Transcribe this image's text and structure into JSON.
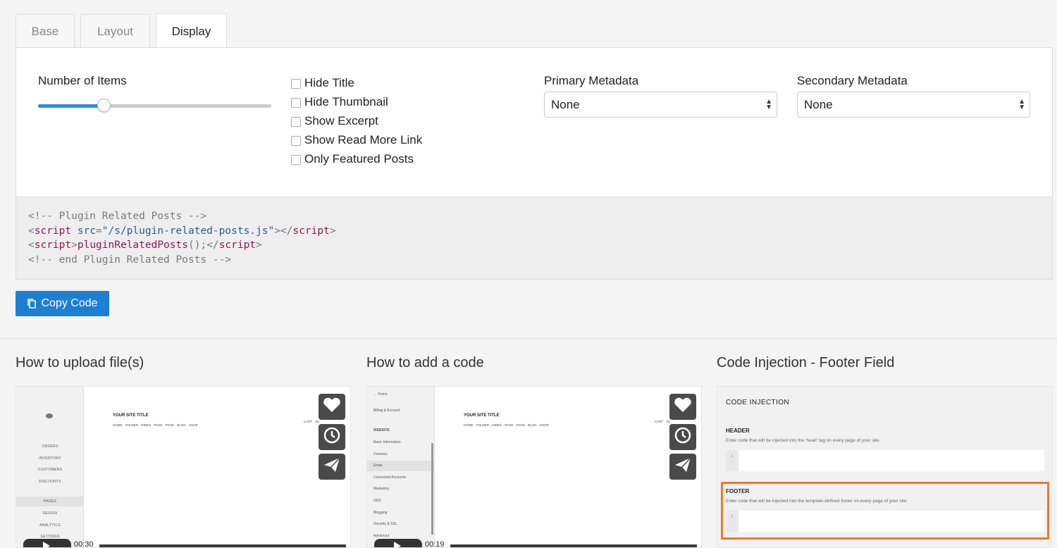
{
  "tabs": [
    {
      "label": "Base",
      "active": false
    },
    {
      "label": "Layout",
      "active": false
    },
    {
      "label": "Display",
      "active": true
    }
  ],
  "display": {
    "number_of_items_label": "Number of Items",
    "number_of_items_fraction": 0.28,
    "checkboxes": [
      {
        "label": "Hide Title",
        "checked": false
      },
      {
        "label": "Hide Thumbnail",
        "checked": false
      },
      {
        "label": "Show Excerpt",
        "checked": false
      },
      {
        "label": "Show Read More Link",
        "checked": false
      },
      {
        "label": "Only Featured Posts",
        "checked": false
      }
    ],
    "primary_metadata_label": "Primary Metadata",
    "primary_metadata_value": "None",
    "secondary_metadata_label": "Secondary Metadata",
    "secondary_metadata_value": "None"
  },
  "code": {
    "line1": "<!-- Plugin Related Posts -->",
    "line2_tag_open": "<script",
    "line2_attr": " src",
    "line2_eq": "=",
    "line2_str": "\"/s/plugin-related-posts.js\"",
    "line2_close": "></",
    "line2_tag_close": "script",
    "line2_end": ">",
    "line3_open_lt": "<",
    "line3_tag": "script",
    "line3_gt": ">",
    "line3_call": "pluginRelatedPosts",
    "line3_parens": "();</",
    "line3_tag_close": "script",
    "line3_end": ">",
    "line4": "<!-- end Plugin Related Posts -->"
  },
  "copy_button_label": "Copy Code",
  "videos": [
    {
      "title": "How to upload file(s)",
      "time": "00:30",
      "progress": 0.0,
      "site_title": "YOUR SITE TITLE",
      "site_nav": "HOME FOLDER INDEX PAGE PAGE BLOG SHOP",
      "cart": "CART (0)",
      "sidebar_items": [
        "ORDERS",
        "INVENTORY",
        "CUSTOMERS",
        "DISCOUNTS",
        "PAGES",
        "DESIGN",
        "ANALYTICS",
        "SETTINGS"
      ]
    },
    {
      "title": "How to add a code",
      "time": "00:19",
      "progress": 0.0,
      "site_title": "YOUR SITE TITLE",
      "site_nav": "HOME FOLDER INDEX PAGE PAGE BLOG SHOP",
      "cart": "CART (0)",
      "sidebar_items": [
        "Home",
        "Billing & Account",
        "WEBSITE",
        "Basic Information",
        "Domains",
        "Email",
        "Connected Accounts",
        "Marketing",
        "SEO",
        "Blogging",
        "Security & SSL",
        "Advanced"
      ]
    }
  ],
  "code_injection": {
    "title": "Code Injection - Footer Field",
    "heading": "CODE INJECTION",
    "header_label": "HEADER",
    "header_desc": "Enter code that will be injected into the 'head' tag on every page of your site.",
    "footer_label": "FOOTER",
    "footer_desc": "Enter code that will be injected into the template-defined footer on every page of your site.",
    "line_number": "1",
    "highlight_color": "#ec7a2a"
  },
  "colors": {
    "accent": "#1d7fd1",
    "slider_fill": "#2b8fd6"
  }
}
